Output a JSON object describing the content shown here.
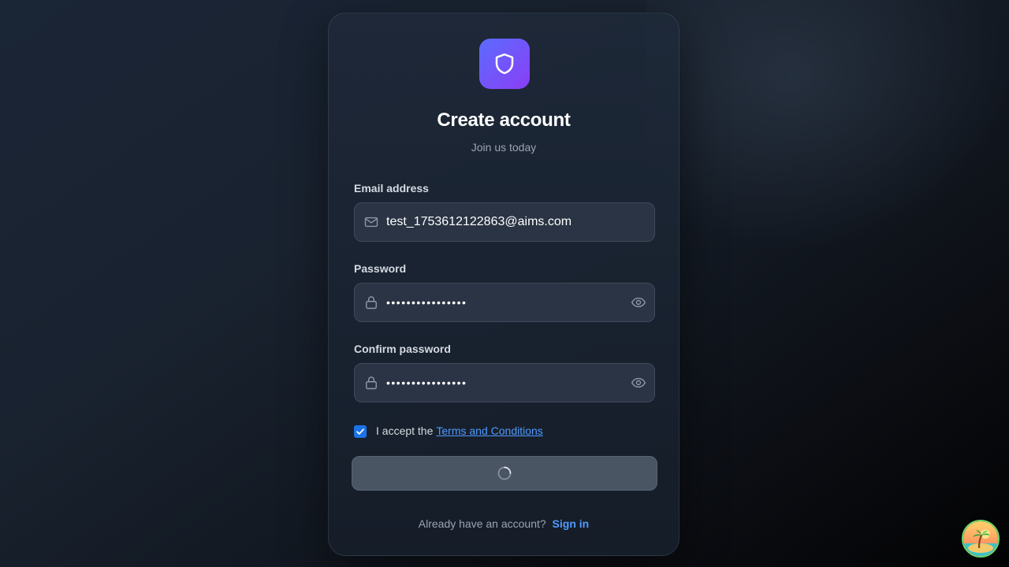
{
  "header": {
    "logo_icon": "shield-icon",
    "title": "Create account",
    "subtitle": "Join us today"
  },
  "form": {
    "email": {
      "label": "Email address",
      "value": "test_1753612122863@aims.com",
      "icon": "mail-icon"
    },
    "password": {
      "label": "Password",
      "value": "••••••••••••••••",
      "icon": "lock-icon",
      "toggle_icon": "eye-icon"
    },
    "confirm_password": {
      "label": "Confirm password",
      "value": "••••••••••••••••",
      "icon": "lock-icon",
      "toggle_icon": "eye-icon"
    },
    "terms": {
      "checked": true,
      "text": "I accept the",
      "link": "Terms and Conditions"
    },
    "submit": {
      "state": "loading",
      "icon": "spinner-icon"
    }
  },
  "footer": {
    "question": "Already have an account?",
    "link": "Sign in"
  },
  "colors": {
    "accent": "#4f9bff",
    "logo_gradient_start": "#5b6cff",
    "logo_gradient_end": "#8b3ef5",
    "checkbox": "#1a73e8"
  }
}
